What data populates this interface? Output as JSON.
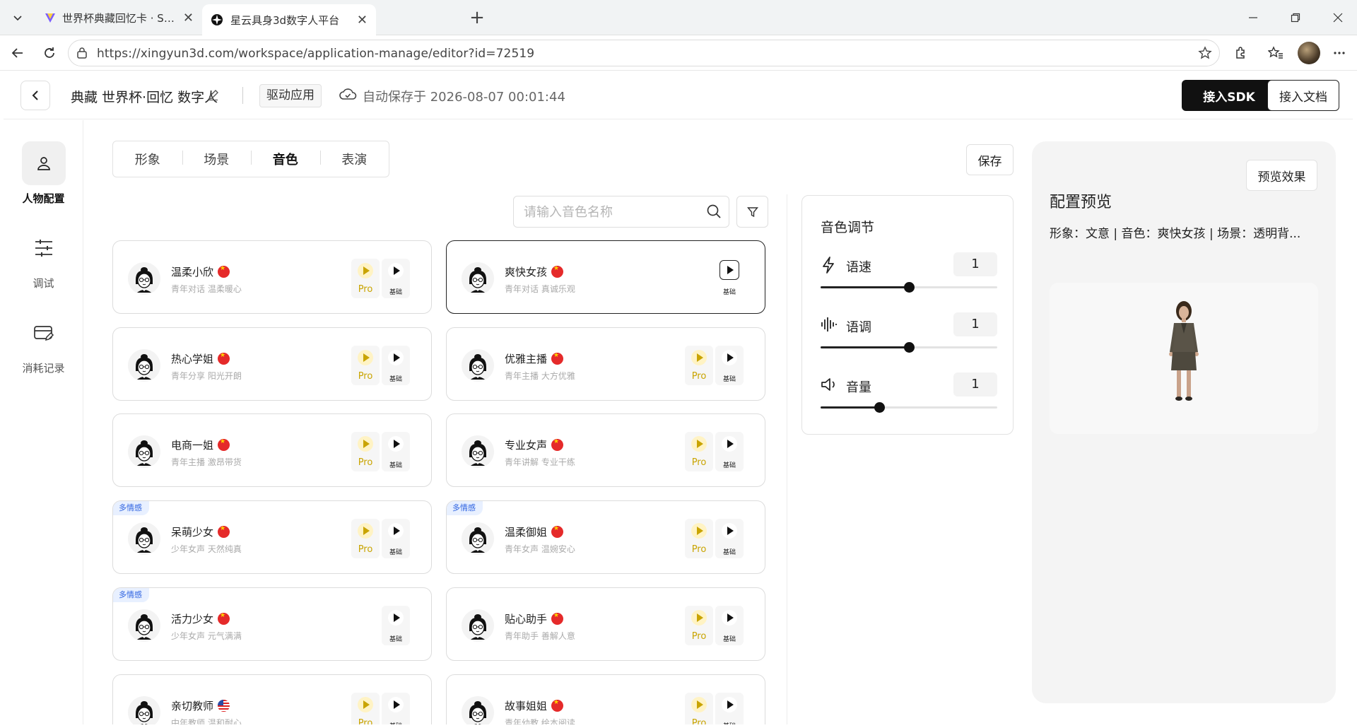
{
  "browser": {
    "tabs": [
      {
        "title": "世界杯典藏回忆卡 · Seed Chronicle",
        "active": false
      },
      {
        "title": "星云具身3d数字人平台",
        "active": true
      }
    ],
    "url": "https://xingyun3d.com/workspace/application-manage/editor?id=72519"
  },
  "header": {
    "project_name": "典藏 世界杯·回忆 数字人",
    "drive_tag": "驱动应用",
    "autosave": "自动保存于 2026-08-07 00:01:44",
    "sdk_button": "接入SDK",
    "doc_button": "接入文档"
  },
  "rail": {
    "items": [
      {
        "label": "人物配置",
        "icon": "person-icon",
        "active": true
      },
      {
        "label": "调试",
        "icon": "sliders-icon",
        "active": false
      },
      {
        "label": "消耗记录",
        "icon": "card-edit-icon",
        "active": false
      }
    ]
  },
  "tabs": [
    "形象",
    "场景",
    "音色",
    "表演"
  ],
  "active_tab": "音色",
  "save_button": "保存",
  "search": {
    "placeholder": "请输入音色名称"
  },
  "voices": [
    {
      "name": "温柔小欣",
      "desc": "青年对话 温柔暖心",
      "flag": "cn",
      "pro": true,
      "pro_label": "Pro",
      "basic_label": "基础",
      "tag": ""
    },
    {
      "name": "爽快女孩",
      "desc": "青年对话 真诚乐观",
      "flag": "cn",
      "pro": false,
      "pro_label": "",
      "basic_label": "基础",
      "tag": "",
      "selected": true
    },
    {
      "name": "热心学姐",
      "desc": "青年分享 阳光开朗",
      "flag": "cn",
      "pro": true,
      "pro_label": "Pro",
      "basic_label": "基础",
      "tag": ""
    },
    {
      "name": "优雅主播",
      "desc": "青年主播 大方优雅",
      "flag": "cn",
      "pro": true,
      "pro_label": "Pro",
      "basic_label": "基础",
      "tag": ""
    },
    {
      "name": "电商一姐",
      "desc": "青年主播 激昂带货",
      "flag": "cn",
      "pro": true,
      "pro_label": "Pro",
      "basic_label": "基础",
      "tag": ""
    },
    {
      "name": "专业女声",
      "desc": "青年讲解 专业干练",
      "flag": "cn",
      "pro": true,
      "pro_label": "Pro",
      "basic_label": "基础",
      "tag": ""
    },
    {
      "name": "呆萌少女",
      "desc": "少年女声 天然纯真",
      "flag": "cn",
      "pro": true,
      "pro_label": "Pro",
      "basic_label": "基础",
      "tag": "多情感"
    },
    {
      "name": "温柔御姐",
      "desc": "青年女声 温婉安心",
      "flag": "cn",
      "pro": true,
      "pro_label": "Pro",
      "basic_label": "基础",
      "tag": "多情感"
    },
    {
      "name": "活力少女",
      "desc": "少年女声 元气满满",
      "flag": "cn",
      "pro": false,
      "pro_label": "",
      "basic_label": "基础",
      "tag": "多情感"
    },
    {
      "name": "贴心助手",
      "desc": "青年助手 善解人意",
      "flag": "cn",
      "pro": true,
      "pro_label": "Pro",
      "basic_label": "基础",
      "tag": ""
    },
    {
      "name": "亲切教师",
      "desc": "中年教师 温和耐心",
      "flag": "us",
      "pro": true,
      "pro_label": "Pro",
      "basic_label": "基础",
      "tag": ""
    },
    {
      "name": "故事姐姐",
      "desc": "青年幼教 绘本阅读",
      "flag": "cn",
      "pro": true,
      "pro_label": "Pro",
      "basic_label": "基础",
      "tag": ""
    }
  ],
  "adjust": {
    "title": "音色调节",
    "rows": [
      {
        "label": "语速",
        "icon": "bolt-icon",
        "value": "1",
        "level": 0.5
      },
      {
        "label": "语调",
        "icon": "waveform-icon",
        "value": "1",
        "level": 0.5
      },
      {
        "label": "音量",
        "icon": "speaker-icon",
        "value": "1",
        "level": 0.33
      }
    ]
  },
  "preview": {
    "button": "预览效果",
    "title": "配置预览",
    "info": "形象：文意 | 音色：爽快女孩 | 场景：透明背..."
  }
}
